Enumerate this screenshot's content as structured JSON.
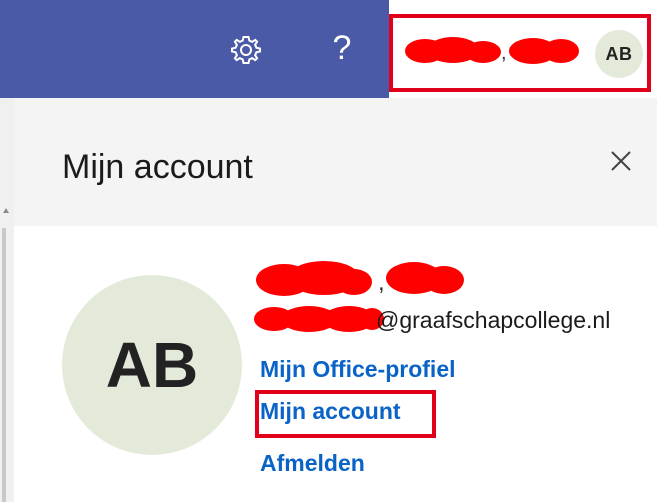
{
  "topbar": {
    "settings_icon": "gear-icon",
    "help_label": "?",
    "user_name_separator": ",",
    "avatar_initials": "AB"
  },
  "panel": {
    "title": "Mijn account",
    "close_icon": "close-icon",
    "avatar_initials": "AB",
    "name_separator": ",",
    "email_domain": "@graafschapcollege.nl",
    "links": {
      "profile": "Mijn Office-profiel",
      "account": "Mijn account",
      "logout": "Afmelden"
    }
  },
  "colors": {
    "topbar_blue": "#4b5aa6",
    "highlight_red": "#e0001a",
    "link_blue": "#0a63c7",
    "avatar_bg": "#e4ead9"
  }
}
